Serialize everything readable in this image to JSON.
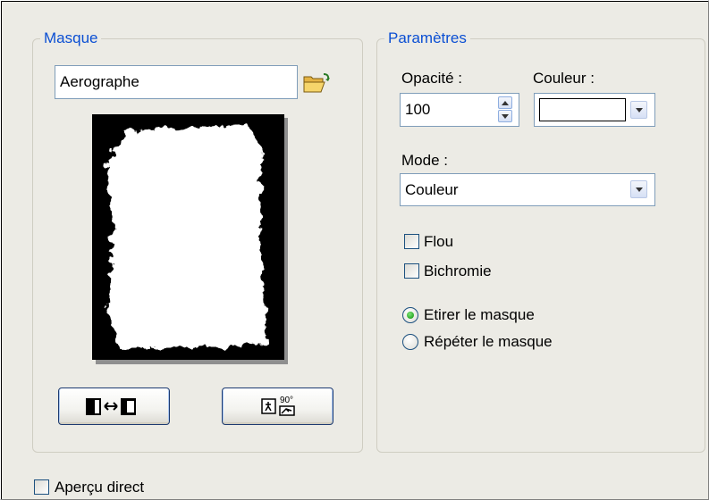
{
  "masque": {
    "group_title": "Masque",
    "name_value": "Aerographe",
    "load_icon": "folder-open-icon",
    "button1_icon": "swap-invert-icon",
    "button2_icon": "rotate-90-icon",
    "button2_text": "90°"
  },
  "parametres": {
    "group_title": "Paramètres",
    "opacity_label": "Opacité :",
    "opacity_value": "100",
    "color_label": "Couleur :",
    "color_value": "#ffffff",
    "mode_label": "Mode :",
    "mode_value": "Couleur",
    "flou_label": "Flou",
    "flou_checked": false,
    "bichromie_label": "Bichromie",
    "bichromie_checked": false,
    "radio_etirer_label": "Etirer le masque",
    "radio_repeter_label": "Répéter le masque",
    "selected_radio": "etirer"
  },
  "apercu": {
    "label": "Aperçu direct",
    "checked": false
  },
  "colors": {
    "accent": "#0b4fd3",
    "background": "#ecebe5"
  }
}
